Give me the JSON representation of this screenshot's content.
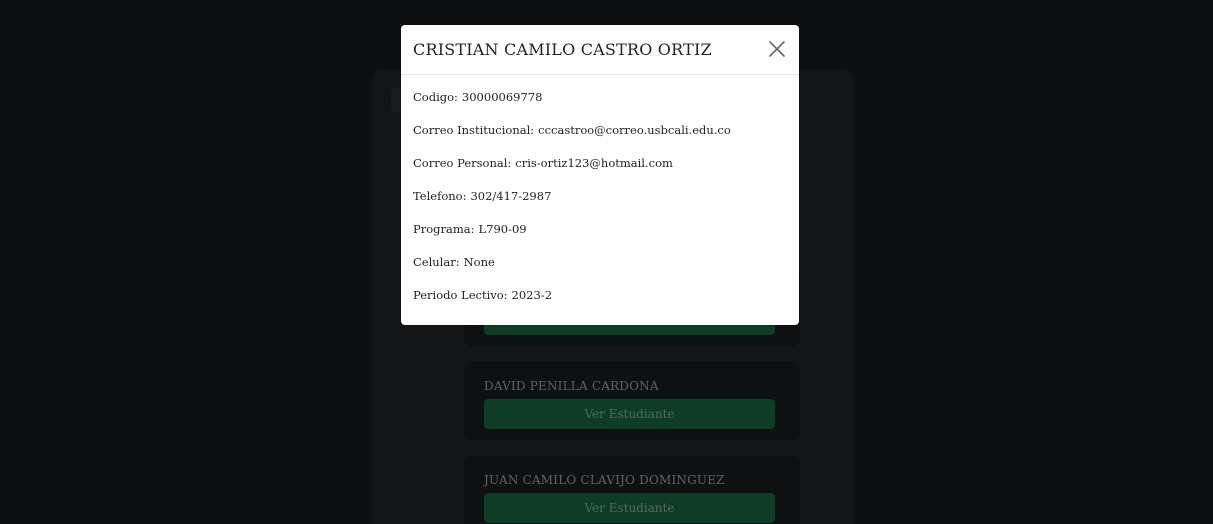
{
  "modal": {
    "title": "CRISTIAN CAMILO CASTRO ORTIZ",
    "close_icon": "close-icon",
    "fields": [
      {
        "label": "Codigo:",
        "value": "30000069778"
      },
      {
        "label": "Correo Institucional:",
        "value": "cccastroo@correo.usbcali.edu.co"
      },
      {
        "label": "Correo Personal:",
        "value": "cris-ortiz123@hotmail.com"
      },
      {
        "label": "Telefono:",
        "value": "302/417-2987"
      },
      {
        "label": "Programa:",
        "value": "L790-09"
      },
      {
        "label": "Celular:",
        "value": "None"
      },
      {
        "label": "Periodo Lectivo:",
        "value": "2023-2"
      }
    ]
  },
  "students": [
    {
      "name": "",
      "button": ""
    },
    {
      "name": "DAVID PENILLA CARDONA",
      "button": "Ver Estudiante"
    },
    {
      "name": "JUAN CAMILO CLAVIJO DOMINGUEZ",
      "button": "Ver Estudiante"
    }
  ],
  "colors": {
    "overlay": "#0e0f10",
    "button": "#0f3c24",
    "modal_bg": "#ffffff"
  }
}
